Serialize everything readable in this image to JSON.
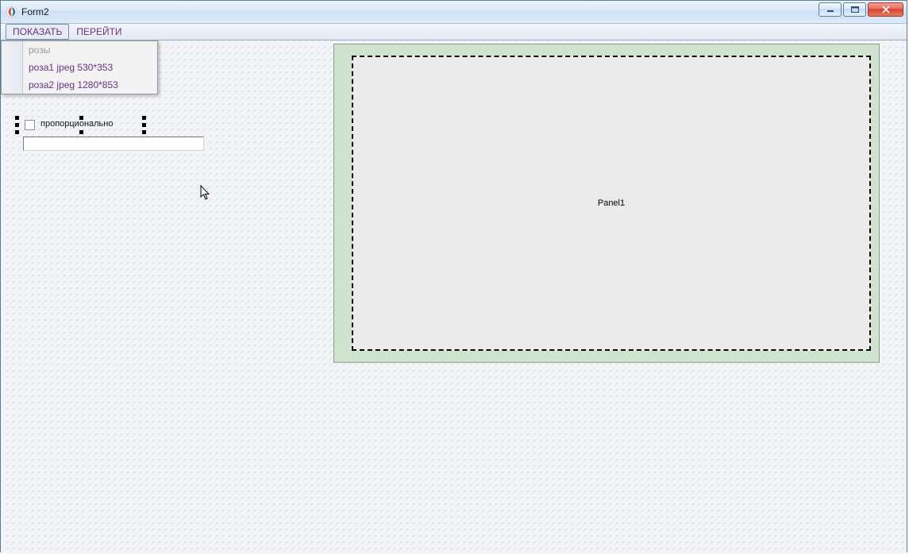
{
  "window": {
    "title": "Form2"
  },
  "menubar": {
    "items": [
      {
        "label": "ПОКАЗАТЬ",
        "active": true
      },
      {
        "label": "ПЕРЕЙТИ",
        "active": false
      }
    ]
  },
  "dropdown": {
    "items": [
      {
        "label": "розы",
        "disabled": true
      },
      {
        "label": "роза1 jpeg 530*353",
        "disabled": false
      },
      {
        "label": "роза2 jpeg 1280*853",
        "disabled": false
      }
    ]
  },
  "checkbox": {
    "label": "пропорционально"
  },
  "edit": {
    "value": ""
  },
  "panel": {
    "caption": "Panel1"
  }
}
